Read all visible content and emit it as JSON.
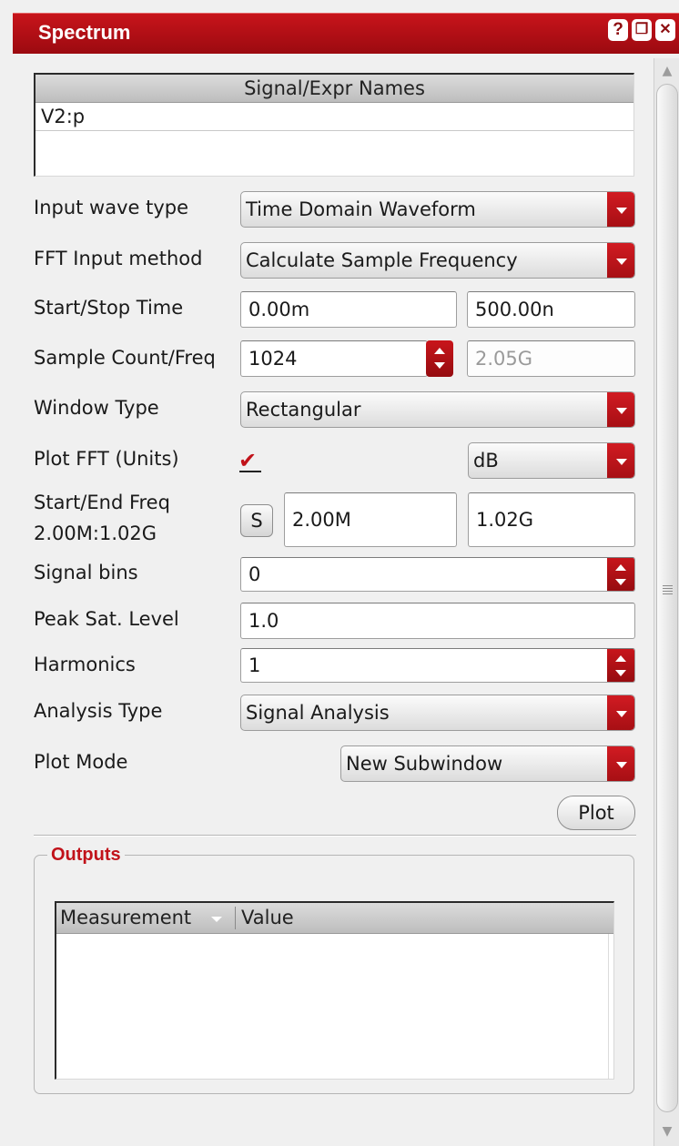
{
  "window": {
    "title": "Spectrum",
    "help_label": "?",
    "float_label": "❐",
    "close_label": "✕"
  },
  "signal_table": {
    "header": "Signal/Expr Names",
    "rows": [
      "V2:p"
    ]
  },
  "form": {
    "input_wave_type": {
      "label": "Input wave type",
      "value": "Time Domain Waveform"
    },
    "fft_input_method": {
      "label": "FFT Input method",
      "value": "Calculate Sample Frequency"
    },
    "start_stop_time": {
      "label": "Start/Stop Time",
      "start": "0.00m",
      "stop": "500.00n"
    },
    "sample_count_freq": {
      "label": "Sample Count/Freq",
      "count": "1024",
      "freq": "2.05G"
    },
    "window_type": {
      "label": "Window Type",
      "value": "Rectangular"
    },
    "plot_fft": {
      "label": "Plot FFT (Units)",
      "checked": true,
      "check_glyph": "✔",
      "units": "dB"
    },
    "start_end_freq": {
      "label": "Start/End Freq",
      "sublabel": "2.00M:1.02G",
      "button": "S",
      "start": "2.00M",
      "end": "1.02G"
    },
    "signal_bins": {
      "label": "Signal bins",
      "value": "0"
    },
    "peak_sat_level": {
      "label": "Peak Sat. Level",
      "value": "1.0"
    },
    "harmonics": {
      "label": "Harmonics",
      "value": "1"
    },
    "analysis_type": {
      "label": "Analysis Type",
      "value": "Signal Analysis"
    },
    "plot_mode": {
      "label": "Plot Mode",
      "value": "New Subwindow"
    },
    "plot_button": "Plot"
  },
  "outputs": {
    "title": "Outputs",
    "columns": [
      "Measurement",
      "Value"
    ]
  },
  "colors": {
    "accent": "#c1121a",
    "titlebar": "#b0101a"
  },
  "icons": {
    "help": "help-icon",
    "float": "float-icon",
    "close": "close-icon",
    "dropdown": "chevron-down-icon",
    "spinner": "spinner-icon"
  }
}
